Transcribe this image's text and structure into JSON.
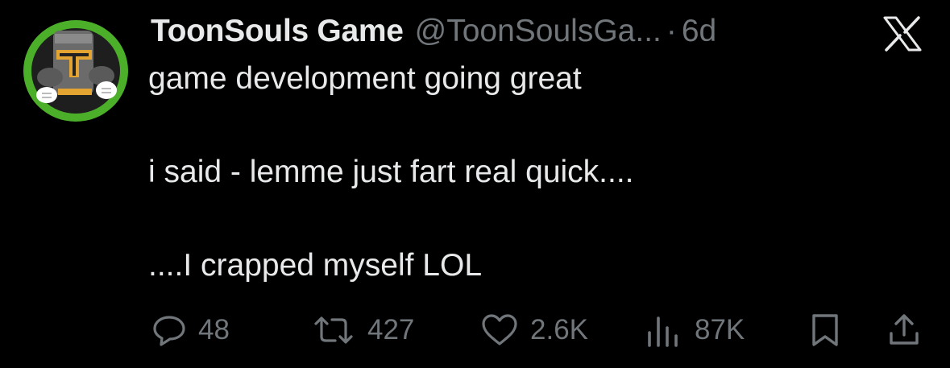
{
  "tweet": {
    "display_name": "ToonSouls Game",
    "handle": "@ToonSoulsGa...",
    "separator": "·",
    "time": "6d",
    "lines": [
      "game development going great",
      "i said - lemme just fart real quick....",
      "....I crapped myself  LOL"
    ]
  },
  "actions": {
    "replies": "48",
    "reposts": "427",
    "likes": "2.6K",
    "views": "87K"
  },
  "icons": {
    "logo": "x-logo-icon",
    "reply": "reply-icon",
    "repost": "repost-icon",
    "like": "heart-icon",
    "views": "views-icon",
    "bookmark": "bookmark-icon",
    "share": "share-icon"
  },
  "colors": {
    "background": "#000000",
    "text": "#e7e9ea",
    "muted": "#71767b",
    "avatar_ring": "#4caf2a"
  }
}
